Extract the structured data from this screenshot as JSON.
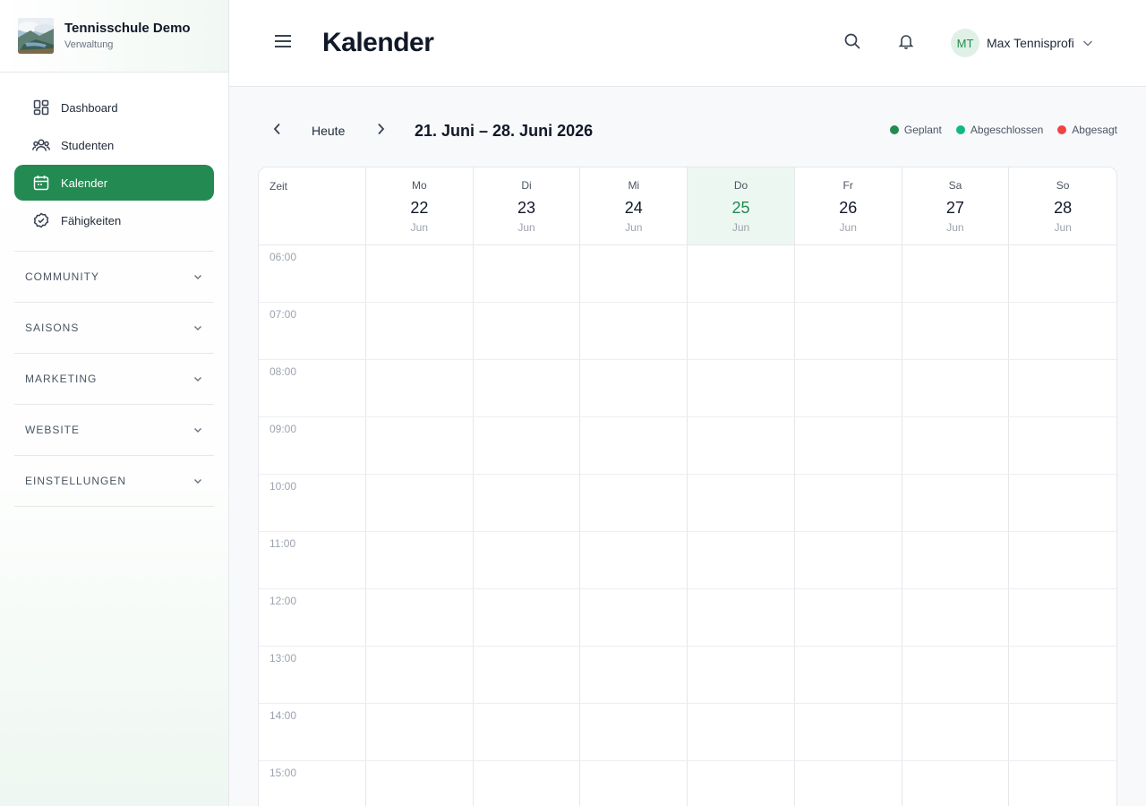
{
  "brand": {
    "name": "Tennisschule Demo",
    "subtitle": "Verwaltung"
  },
  "sidebar": {
    "items": [
      {
        "label": "Dashboard",
        "icon": "dashboard-icon",
        "active": false
      },
      {
        "label": "Studenten",
        "icon": "users-icon",
        "active": false
      },
      {
        "label": "Kalender",
        "icon": "calendar-icon",
        "active": true
      },
      {
        "label": "Fähigkeiten",
        "icon": "check-circle-icon",
        "active": false
      }
    ],
    "sections": [
      {
        "label": "COMMUNITY"
      },
      {
        "label": "SAISONS"
      },
      {
        "label": "MARKETING"
      },
      {
        "label": "WEBSITE"
      },
      {
        "label": "EINSTELLUNGEN"
      }
    ]
  },
  "header": {
    "title": "Kalender",
    "user": {
      "initials": "MT",
      "name": "Max Tennisprofi"
    }
  },
  "toolbar": {
    "today_label": "Heute",
    "range_label": "21. Juni – 28. Juni 2026",
    "legend": [
      {
        "label": "Geplant",
        "color": "#238a52"
      },
      {
        "label": "Abgeschlossen",
        "color": "#10b981"
      },
      {
        "label": "Abgesagt",
        "color": "#ef4444"
      }
    ]
  },
  "calendar": {
    "time_header": "Zeit",
    "days": [
      {
        "name": "Mo",
        "date": "22",
        "month": "Jun",
        "today": false
      },
      {
        "name": "Di",
        "date": "23",
        "month": "Jun",
        "today": false
      },
      {
        "name": "Mi",
        "date": "24",
        "month": "Jun",
        "today": false
      },
      {
        "name": "Do",
        "date": "25",
        "month": "Jun",
        "today": true
      },
      {
        "name": "Fr",
        "date": "26",
        "month": "Jun",
        "today": false
      },
      {
        "name": "Sa",
        "date": "27",
        "month": "Jun",
        "today": false
      },
      {
        "name": "So",
        "date": "28",
        "month": "Jun",
        "today": false
      }
    ],
    "times": [
      "06:00",
      "07:00",
      "08:00",
      "09:00",
      "10:00",
      "11:00",
      "12:00",
      "13:00",
      "14:00",
      "15:00"
    ]
  },
  "colors": {
    "accent": "#238a52",
    "today_bg": "#edf7f1"
  }
}
